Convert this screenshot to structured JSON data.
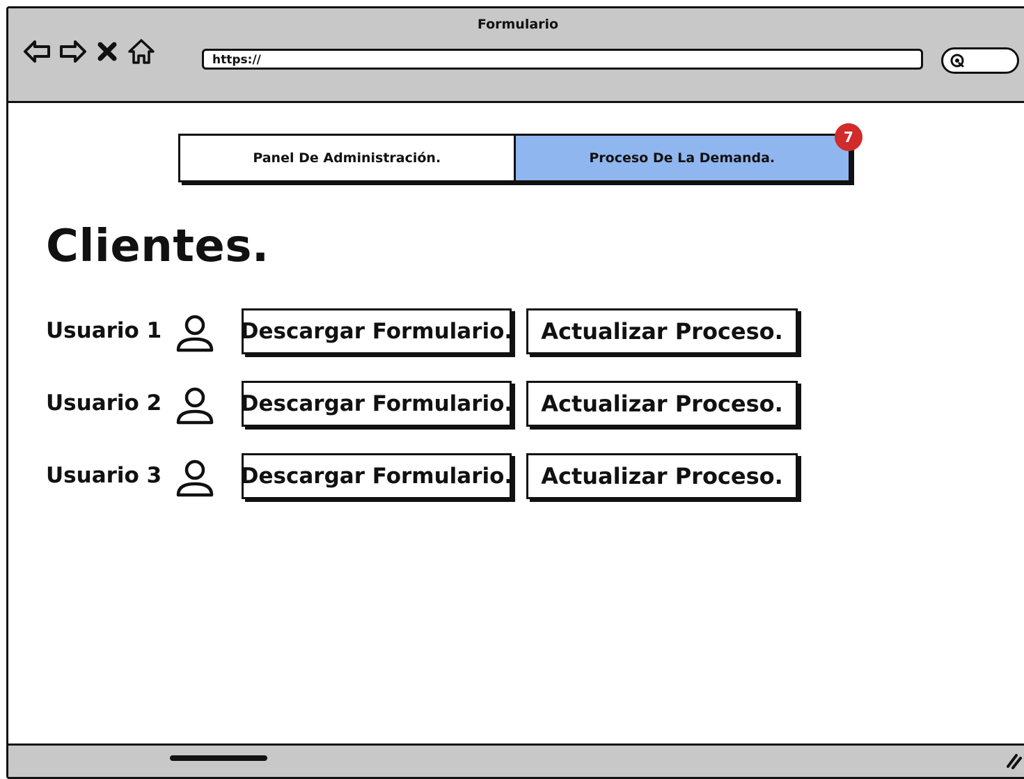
{
  "window": {
    "title": "Formulario"
  },
  "browser": {
    "url": "https://",
    "nav_icons": [
      "back-arrow-icon",
      "forward-arrow-icon",
      "close-icon",
      "home-icon"
    ],
    "search_icon": "search-icon"
  },
  "tabs": [
    {
      "label": "Panel De Administración.",
      "active": false
    },
    {
      "label": "Proceso De La Demanda.",
      "active": true
    }
  ],
  "notification_badge": "7",
  "page_title": "Clientes.",
  "clients": [
    {
      "name": "Usuario 1",
      "download_label": "Descargar Formulario.",
      "update_label": "Actualizar Proceso."
    },
    {
      "name": "Usuario 2",
      "download_label": "Descargar Formulario.",
      "update_label": "Actualizar Proceso."
    },
    {
      "name": "Usuario 3",
      "download_label": "Descargar Formulario.",
      "update_label": "Actualizar Proceso."
    }
  ],
  "colors": {
    "active_tab": "#8fb6ef",
    "badge": "#d12b2b",
    "chrome": "#c8c8c8"
  }
}
